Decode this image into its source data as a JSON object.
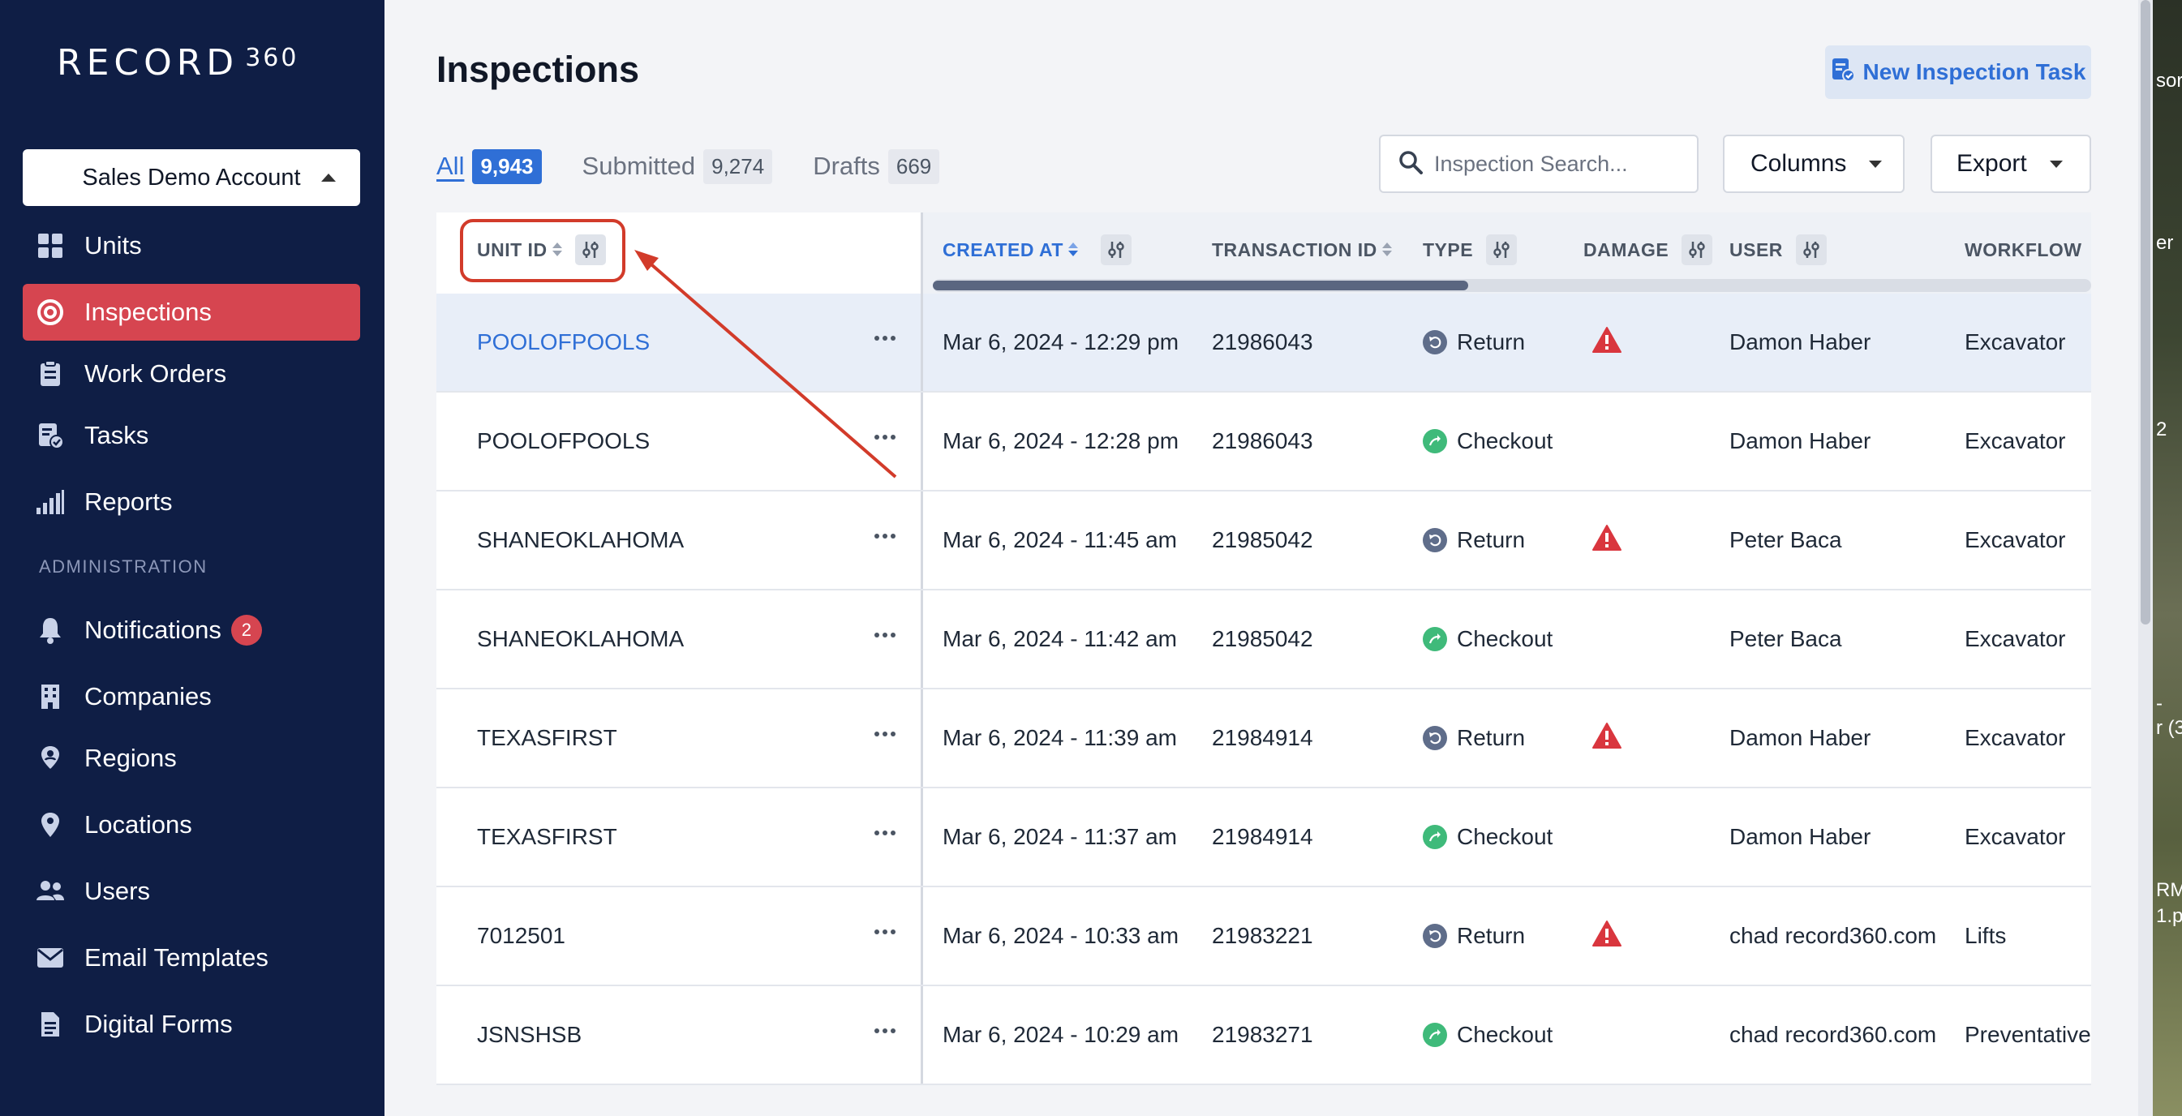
{
  "brand": {
    "logo_text": "RECORD",
    "logo_number": "360"
  },
  "sidebar": {
    "account": "Sales Demo Account",
    "items": [
      {
        "label": "Units",
        "icon": "grid-icon"
      },
      {
        "label": "Inspections",
        "icon": "target-icon",
        "active": true
      },
      {
        "label": "Work Orders",
        "icon": "clipboard-icon"
      },
      {
        "label": "Tasks",
        "icon": "task-check-icon"
      },
      {
        "label": "Reports",
        "icon": "bar-signal-icon"
      }
    ],
    "admin_label": "ADMINISTRATION",
    "admin_items": [
      {
        "label": "Notifications",
        "icon": "bell-icon",
        "badge": "2"
      },
      {
        "label": "Companies",
        "icon": "building-icon"
      },
      {
        "label": "Regions",
        "icon": "map-pin-user-icon"
      },
      {
        "label": "Locations",
        "icon": "location-pin-icon"
      },
      {
        "label": "Users",
        "icon": "users-icon"
      },
      {
        "label": "Email Templates",
        "icon": "envelope-icon"
      },
      {
        "label": "Digital Forms",
        "icon": "document-icon"
      }
    ]
  },
  "header": {
    "title": "Inspections",
    "new_task_label": "New Inspection Task"
  },
  "tabs": [
    {
      "label": "All",
      "count": "9,943",
      "active": true
    },
    {
      "label": "Submitted",
      "count": "9,274"
    },
    {
      "label": "Drafts",
      "count": "669"
    }
  ],
  "toolbar": {
    "search_placeholder": "Inspection Search...",
    "columns_label": "Columns",
    "export_label": "Export"
  },
  "table": {
    "columns": {
      "unit_id": "UNIT ID",
      "created_at": "CREATED AT",
      "transaction_id": "TRANSACTION ID",
      "type": "TYPE",
      "damage": "DAMAGE",
      "user": "USER",
      "workflow": "WORKFLOW"
    },
    "rows": [
      {
        "unit": "POOLOFPOOLS",
        "created": "Mar 6, 2024 - 12:29 pm",
        "txn": "21986043",
        "type": "Return",
        "damage": true,
        "user": "Damon Haber",
        "workflow": "Excavator"
      },
      {
        "unit": "POOLOFPOOLS",
        "created": "Mar 6, 2024 - 12:28 pm",
        "txn": "21986043",
        "type": "Checkout",
        "damage": false,
        "user": "Damon Haber",
        "workflow": "Excavator"
      },
      {
        "unit": "SHANEOKLAHOMA",
        "created": "Mar 6, 2024 - 11:45 am",
        "txn": "21985042",
        "type": "Return",
        "damage": true,
        "user": "Peter Baca",
        "workflow": "Excavator"
      },
      {
        "unit": "SHANEOKLAHOMA",
        "created": "Mar 6, 2024 - 11:42 am",
        "txn": "21985042",
        "type": "Checkout",
        "damage": false,
        "user": "Peter Baca",
        "workflow": "Excavator"
      },
      {
        "unit": "TEXASFIRST",
        "created": "Mar 6, 2024 - 11:39 am",
        "txn": "21984914",
        "type": "Return",
        "damage": true,
        "user": "Damon Haber",
        "workflow": "Excavator"
      },
      {
        "unit": "TEXASFIRST",
        "created": "Mar 6, 2024 - 11:37 am",
        "txn": "21984914",
        "type": "Checkout",
        "damage": false,
        "user": "Damon Haber",
        "workflow": "Excavator"
      },
      {
        "unit": "7012501",
        "created": "Mar 6, 2024 - 10:33 am",
        "txn": "21983221",
        "type": "Return",
        "damage": true,
        "user": "chad record360.com",
        "workflow": "Lifts"
      },
      {
        "unit": "JSNSHSB",
        "created": "Mar 6, 2024 - 10:29 am",
        "txn": "21983271",
        "type": "Checkout",
        "damage": false,
        "user": "chad record360.com",
        "workflow": "Preventative"
      }
    ]
  },
  "colors": {
    "sidebar_bg": "#0f1e45",
    "active_nav": "#d64550",
    "accent_blue": "#2f6fd6",
    "annotation_red": "#d23b2a",
    "damage_red": "#d9363e",
    "checkout_green": "#3fba7a",
    "return_gray": "#5f6d8a"
  },
  "edge_text": [
    "sor",
    "er",
    "2",
    "- ",
    "r (3",
    "RMS",
    "1.p"
  ]
}
